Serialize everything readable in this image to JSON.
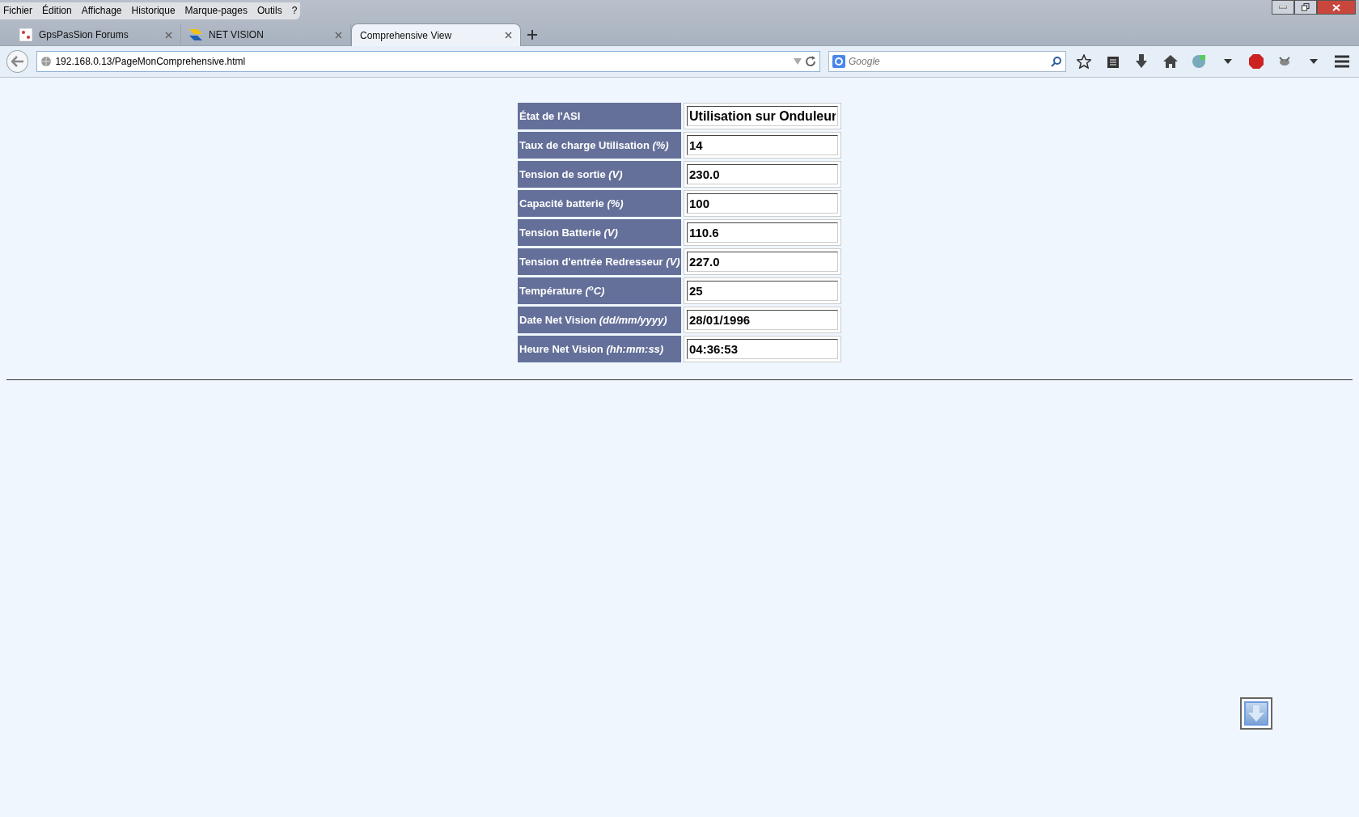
{
  "menu_bar": [
    "Fichier",
    "Édition",
    "Affichage",
    "Historique",
    "Marque-pages",
    "Outils",
    "?"
  ],
  "tabs": [
    {
      "title": "GpsPasSion Forums",
      "selected": false
    },
    {
      "title": "NET VISION",
      "selected": false
    },
    {
      "title": "Comprehensive View",
      "selected": true
    }
  ],
  "address_bar": {
    "value": "192.168.0.13/PageMonComprehensive.html"
  },
  "search": {
    "placeholder": "Google"
  },
  "status_table": {
    "rows": [
      {
        "label": "État de l'ASI",
        "value": "Utilisation sur Onduleur"
      },
      {
        "label": "Taux de charge Utilisation *(%)*",
        "value": "14"
      },
      {
        "label": "Tension de sortie *(V)*",
        "value": "230.0"
      },
      {
        "label": "Capacité batterie *(%)*",
        "value": "100"
      },
      {
        "label": "Tension Batterie *(V)*",
        "value": "110.6"
      },
      {
        "label": "Tension d'entrée Redresseur *(V)*",
        "value": "227.0"
      },
      {
        "label": "Température *(*$^{o}$*C)*",
        "value": "25"
      },
      {
        "label": "Date Net Vision *(dd/mm/yyyy)*",
        "value": "28/01/1996"
      },
      {
        "label": "Heure Net Vision *(hh:mm:ss)*",
        "value": "04:36:53"
      }
    ]
  }
}
